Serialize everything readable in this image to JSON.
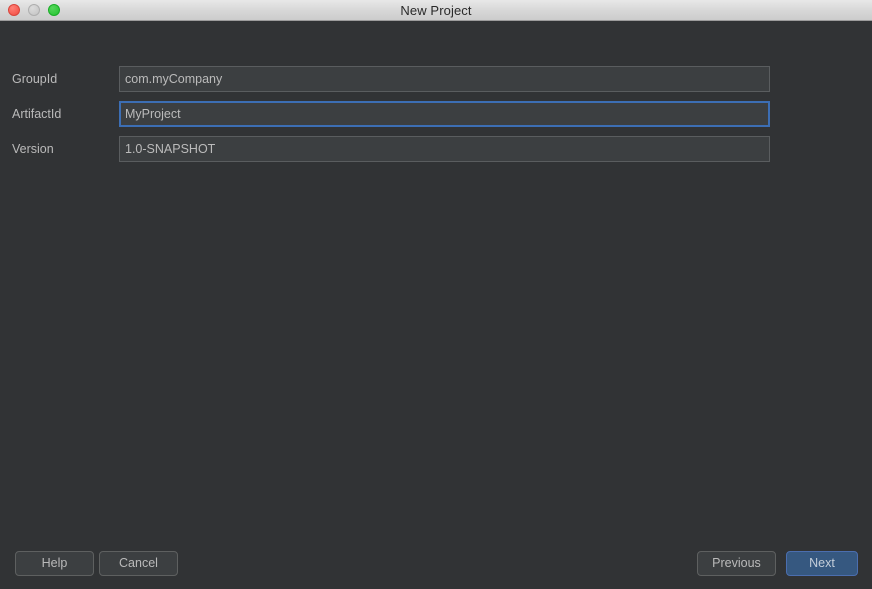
{
  "window": {
    "title": "New Project",
    "controls": {
      "close": "close-button",
      "minimize": "minimize-button",
      "zoom": "zoom-button"
    }
  },
  "form": {
    "fields": [
      {
        "label": "GroupId",
        "value": "com.myCompany",
        "placeholder": "",
        "focused": false
      },
      {
        "label": "ArtifactId",
        "value": "MyProject",
        "placeholder": "",
        "focused": true
      },
      {
        "label": "Version",
        "value": "1.0-SNAPSHOT",
        "placeholder": "",
        "focused": false
      }
    ]
  },
  "footer": {
    "help_label": "Help",
    "cancel_label": "Cancel",
    "previous_label": "Previous",
    "next_label": "Next"
  },
  "colors": {
    "dialog_background": "#313335",
    "field_background": "#3c3f41",
    "field_border": "#5a5d5f",
    "focus_border": "#3c6eb4",
    "default_button_background": "#365880",
    "default_button_border": "#4b6eaf",
    "text": "#bababa",
    "titlebar_text": "#2a2a2a",
    "traffic_close": "#f24b41",
    "traffic_minimize": "#c2c2c2",
    "traffic_zoom": "#22c32e"
  }
}
